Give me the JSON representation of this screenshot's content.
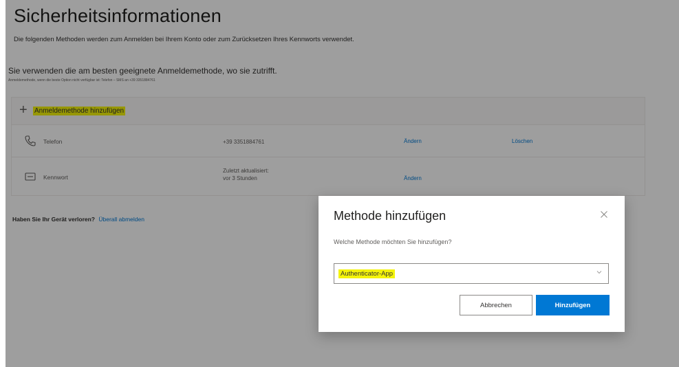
{
  "page": {
    "title": "Sicherheitsinformationen",
    "subtitle": "Die folgenden Methoden werden zum Anmelden bei Ihrem Konto oder zum Zurücksetzen Ihres Kennworts verwendet.",
    "default_method": "Sie verwenden die am besten geeignete Anmeldemethode, wo sie zutrifft.",
    "default_method_sub": "Anmeldemethode, wenn die beste Option nicht verfügbar ist: Telefon – SMS an +39 3351884761"
  },
  "methods": {
    "add_label": "Anmeldemethode hinzufügen",
    "items": [
      {
        "icon": "phone-icon",
        "name": "Telefon",
        "detail_1": "+39 3351884761",
        "detail_2": "",
        "change": "Ändern",
        "delete": "Löschen"
      },
      {
        "icon": "password-icon",
        "name": "Kennwort",
        "detail_1": "Zuletzt aktualisiert:",
        "detail_2": "vor 3 Stunden",
        "change": "Ändern",
        "delete": ""
      }
    ]
  },
  "lost_device": {
    "question": "Haben Sie Ihr Gerät verloren?",
    "link": "Überall abmelden"
  },
  "dialog": {
    "title": "Methode hinzufügen",
    "close_icon": "close-icon",
    "question": "Welche Methode möchten Sie hinzufügen?",
    "selected_value": "Authenticator-App",
    "cancel_label": "Abbrechen",
    "add_label": "Hinzufügen"
  },
  "colors": {
    "accent": "#0078d4",
    "highlight": "#f4f40a",
    "overlay": "rgba(0,0,0,0.38)"
  }
}
